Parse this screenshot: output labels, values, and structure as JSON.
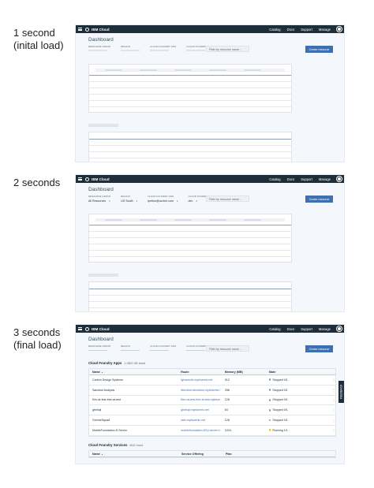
{
  "steps": [
    {
      "label_line1": "1 second",
      "label_line2": "(inital load)"
    },
    {
      "label_line1": "2 seconds",
      "label_line2": ""
    },
    {
      "label_line1": "3 seconds",
      "label_line2": "(final load)"
    }
  ],
  "app": {
    "brand": "IBM Cloud",
    "nav": [
      "Catalog",
      "Docs",
      "Support",
      "Manage"
    ]
  },
  "dashboard": {
    "title": "Dashboard",
    "filters": [
      {
        "label": "RESOURCE GROUP",
        "value": "All Resources"
      },
      {
        "label": "REGION",
        "value": "US South"
      },
      {
        "label": "CLOUD FOUNDRY ORG",
        "value": "tpelton@us.ibm.com"
      },
      {
        "label": "CLOUD FOUNDRY SPACE",
        "value": "dev"
      }
    ],
    "search_placeholder": "Filter by resource name...",
    "create_button": "Create resource"
  },
  "apps_section": {
    "title": "Cloud Foundry Apps",
    "usage": "1 GB/2 GB Used",
    "columns": [
      "Name",
      "Route",
      "Memory (MB)",
      "State"
    ],
    "rows": [
      {
        "name": "Carbon Design Systems",
        "route": "fghaoeoth.mybluemix.net",
        "memory": "512",
        "state": "Stopped 0/1",
        "state_color": "#8c9ba5"
      },
      {
        "name": "Sanction Analysis",
        "route": "fderckne-dhoetuhs.mybluemix.net",
        "memory": "256",
        "state": "Stopped 0/1",
        "state_color": "#8c9ba5"
      },
      {
        "name": "Kev-at-test-free-at-test",
        "route": "fkev-at-test-free-at-test.mybluemix.net",
        "memory": "128",
        "state": "Stopped 0/1",
        "state_color": "#8c9ba5"
      },
      {
        "name": "ghelloji",
        "route": "ghelloji.mybluemix.net",
        "memory": "64",
        "state": "Stopped 0/1",
        "state_color": "#8c9ba5"
      },
      {
        "name": "GnomeSquad",
        "route": "labs.mybluemix.net",
        "memory": "128",
        "state": "Stopped 0/1",
        "state_color": "#8c9ba5"
      },
      {
        "name": "MobileFoundation-S-Server",
        "route": "mobilefoundation-8i7p-server.mybluemix.net",
        "memory": "1024",
        "state": "Running 1/1",
        "state_color": "#efc100"
      }
    ]
  },
  "services_section": {
    "title": "Cloud Foundry Services",
    "usage": "8/10 Used",
    "columns": [
      "Name",
      "Service Offering",
      "Plan"
    ]
  },
  "feedback": "FEEDBACK"
}
